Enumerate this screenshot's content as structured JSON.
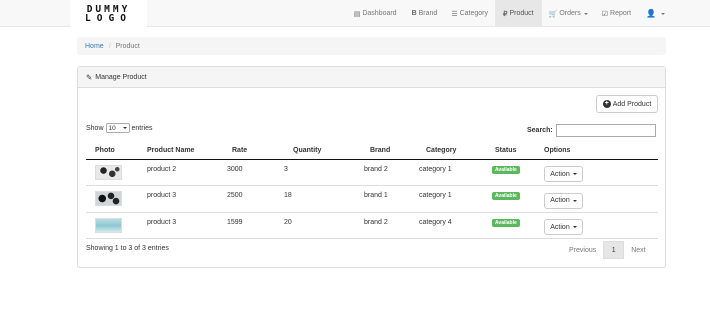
{
  "navbar": {
    "logo_line1": "DUMMY",
    "logo_line2": "LOGO",
    "items": [
      {
        "label": "Dashboard",
        "icon": "list-icon"
      },
      {
        "label": "Brand",
        "icon": "bitcoin-icon"
      },
      {
        "label": "Category",
        "icon": "th-list-icon"
      },
      {
        "label": "Product",
        "icon": "ruble-icon",
        "active": true
      },
      {
        "label": "Orders",
        "icon": "cart-icon",
        "dropdown": true
      },
      {
        "label": "Report",
        "icon": "check-icon"
      },
      {
        "label": "",
        "icon": "user-icon",
        "dropdown": true
      }
    ]
  },
  "breadcrumb": {
    "home": "Home",
    "separator": "/",
    "current": "Product"
  },
  "panel": {
    "title": "Manage Product",
    "add_button": "Add Product",
    "show_label": "Show",
    "entries_value": "10",
    "entries_label": "entries",
    "search_label": "Search:",
    "search_value": "",
    "columns": [
      "Photo",
      "Product Name",
      "Rate",
      "Quantity",
      "Brand",
      "Category",
      "Status",
      "Options"
    ],
    "rows": [
      {
        "photo": "product-photo-1",
        "name": "product 2",
        "rate": "3000",
        "quantity": "3",
        "brand": "brand 2",
        "category": "category 1",
        "status": "Available",
        "action": "Action"
      },
      {
        "photo": "product-photo-2",
        "name": "product 3",
        "rate": "2500",
        "quantity": "18",
        "brand": "brand 1",
        "category": "category 1",
        "status": "Available",
        "action": "Action"
      },
      {
        "photo": "product-photo-3",
        "name": "product 3",
        "rate": "1599",
        "quantity": "20",
        "brand": "brand 2",
        "category": "category 4",
        "status": "Available",
        "action": "Action"
      }
    ],
    "info": "Showing 1 to 3 of 3 entries",
    "pagination": {
      "previous": "Previous",
      "current": "1",
      "next": "Next"
    }
  },
  "colors": {
    "badge": "#5cb85c",
    "link": "#337ab7",
    "navbar_bg": "#f8f8f8",
    "active_nav": "#e7e7e7"
  }
}
